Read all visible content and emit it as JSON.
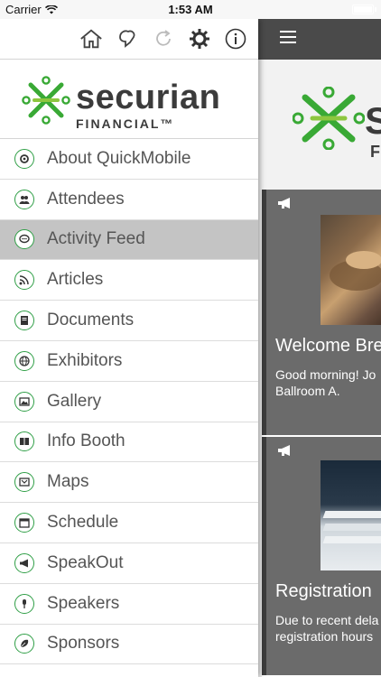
{
  "status_bar": {
    "carrier": "Carrier",
    "time": "1:53 AM"
  },
  "toolbar": {
    "icons": [
      "home-icon",
      "nudge-icon",
      "refresh-icon",
      "gear-icon",
      "info-icon"
    ]
  },
  "brand": {
    "name": "securian",
    "subname": "FINANCIAL™",
    "accent": "#2e9e45",
    "emblem_green": "#39a935",
    "emblem_lime": "#8dc63f"
  },
  "menu": {
    "items": [
      {
        "label": "About QuickMobile",
        "icon": "quickmobile-icon",
        "active": false
      },
      {
        "label": "Attendees",
        "icon": "people-icon",
        "active": false
      },
      {
        "label": "Activity Feed",
        "icon": "chat-icon",
        "active": true
      },
      {
        "label": "Articles",
        "icon": "rss-icon",
        "active": false
      },
      {
        "label": "Documents",
        "icon": "document-icon",
        "active": false
      },
      {
        "label": "Exhibitors",
        "icon": "globe-icon",
        "active": false
      },
      {
        "label": "Gallery",
        "icon": "picture-icon",
        "active": false
      },
      {
        "label": "Info Booth",
        "icon": "book-icon",
        "active": false
      },
      {
        "label": "Maps",
        "icon": "map-icon",
        "active": false
      },
      {
        "label": "Schedule",
        "icon": "calendar-icon",
        "active": false
      },
      {
        "label": "SpeakOut",
        "icon": "megaphone-icon",
        "active": false
      },
      {
        "label": "Speakers",
        "icon": "microphone-icon",
        "active": false
      },
      {
        "label": "Sponsors",
        "icon": "leaf-icon",
        "active": false
      }
    ]
  },
  "feed": {
    "cards": [
      {
        "title": "Welcome Bre",
        "description": "Good morning! Jo\nBallroom A."
      },
      {
        "title": "Registration",
        "description": "Due to recent dela\nregistration hours"
      }
    ]
  }
}
